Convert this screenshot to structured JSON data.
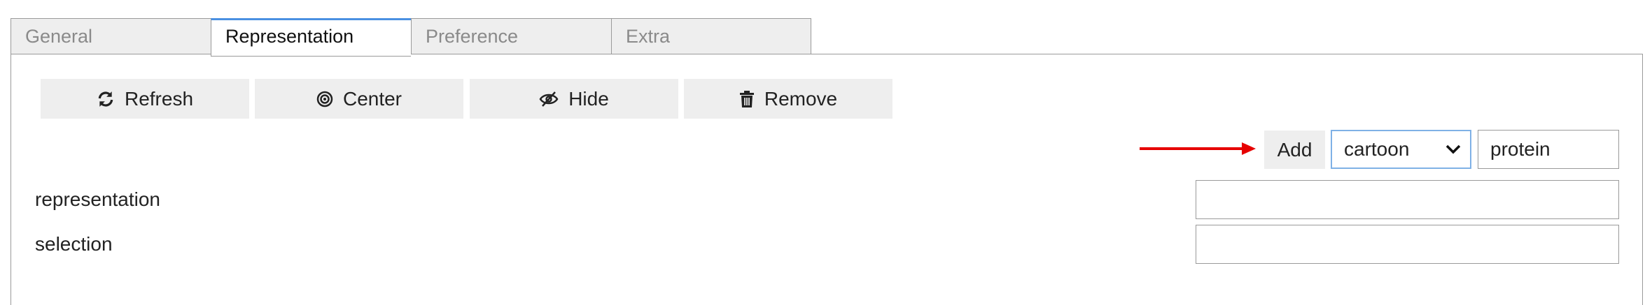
{
  "tabs": [
    "General",
    "Representation",
    "Preference",
    "Extra"
  ],
  "active_tab": "Representation",
  "toolbar": {
    "refresh_label": "Refresh",
    "center_label": "Center",
    "hide_label": "Hide",
    "remove_label": "Remove"
  },
  "add_row": {
    "add_label": "Add",
    "type_select_value": "cartoon",
    "selection_value": "protein"
  },
  "fields": {
    "representation_label": "representation",
    "selection_label": "selection",
    "representation_value": "",
    "selection_value": ""
  },
  "colors": {
    "active_tab_accent": "#4a90e2",
    "annotation_arrow": "#e60000"
  },
  "icons": [
    "refresh-icon",
    "center-icon",
    "hide-icon",
    "trash-icon",
    "chevron-down-icon"
  ]
}
